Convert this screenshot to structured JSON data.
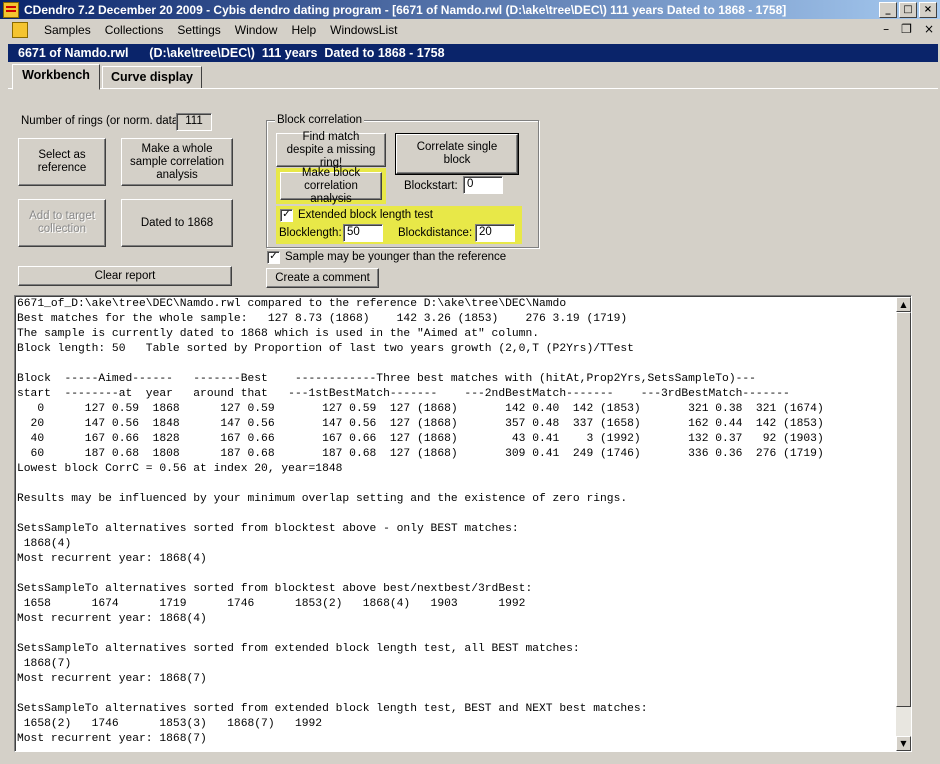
{
  "window": {
    "title": "CDendro 7.2  December 20 2009 - Cybis dendro dating program - [6671 of Namdo.rwl    (D:\\ake\\tree\\DEC\\)  111 years  Dated to 1868 - 1758]",
    "minimize": "_",
    "maximize": "□",
    "close": "×"
  },
  "menu": {
    "items": [
      "Samples",
      "Collections",
      "Settings",
      "Window",
      "Help",
      "WindowsList"
    ],
    "mdi_minimize": "–",
    "mdi_restore": "❐",
    "mdi_close": "×"
  },
  "child_title": "6671 of Namdo.rwl      (D:\\ake\\tree\\DEC\\)  111 years  Dated to 1868 - 1758",
  "tabs": [
    "Workbench",
    "Curve display"
  ],
  "workbench": {
    "rings_label": "Number of rings (or norm. data):",
    "rings_value": "111",
    "select_reference": "Select as reference",
    "whole_sample": "Make a whole sample correlation analysis",
    "add_target": "Add to target collection",
    "dated_to": "Dated to 1868",
    "clear_report": "Clear report",
    "create_comment": "Create a comment"
  },
  "block_correlation": {
    "group_label": "Block correlation",
    "find_match": "Find match despite a missing ring!",
    "make_block": "Make block correlation analysis",
    "correlate_single": "Correlate single block",
    "blockstart_label": "Blockstart:",
    "blockstart_value": "0",
    "extended_label": "Extended block length test",
    "extended_checked": "✓",
    "blocklength_label": "Blocklength:",
    "blocklength_value": "50",
    "blockdistance_label": "Blockdistance:",
    "blockdistance_value": "20",
    "younger_label": "Sample may be younger than the reference",
    "younger_checked": "✓"
  },
  "report_lines": [
    "6671_of_D:\\ake\\tree\\DEC\\Namdo.rwl compared to the reference D:\\ake\\tree\\DEC\\Namdo",
    "Best matches for the whole sample:   127 8.73 (1868)    142 3.26 (1853)    276 3.19 (1719)",
    "The sample is currently dated to 1868 which is used in the \"Aimed at\" column.",
    "Block length: 50   Table sorted by Proportion of last two years growth (2,0,T (P2Yrs)/TTest",
    "",
    "Block  -----Aimed------   -------Best    ------------Three best matches with (hitAt,Prop2Yrs,SetsSampleTo)---",
    "start  --------at  year   around that   ---1stBestMatch-------    ---2ndBestMatch-------    ---3rdBestMatch-------",
    "   0      127 0.59  1868      127 0.59       127 0.59  127 (1868)       142 0.40  142 (1853)       321 0.38  321 (1674)",
    "  20      147 0.56  1848      147 0.56       147 0.56  127 (1868)       357 0.48  337 (1658)       162 0.44  142 (1853)",
    "  40      167 0.66  1828      167 0.66       167 0.66  127 (1868)        43 0.41    3 (1992)       132 0.37   92 (1903)",
    "  60      187 0.68  1808      187 0.68       187 0.68  127 (1868)       309 0.41  249 (1746)       336 0.36  276 (1719)",
    "Lowest block CorrC = 0.56 at index 20, year=1848",
    "",
    "Results may be influenced by your minimum overlap setting and the existence of zero rings.",
    "",
    "SetsSampleTo alternatives sorted from blocktest above - only BEST matches:",
    " 1868(4)",
    "Most recurrent year: 1868(4)",
    "",
    "SetsSampleTo alternatives sorted from blocktest above best/nextbest/3rdBest:",
    " 1658      1674      1719      1746      1853(2)   1868(4)   1903      1992",
    "Most recurrent year: 1868(4)",
    "",
    "SetsSampleTo alternatives sorted from extended block length test, all BEST matches:",
    " 1868(7)",
    "Most recurrent year: 1868(7)",
    "",
    "SetsSampleTo alternatives sorted from extended block length test, BEST and NEXT best matches:",
    " 1658(2)   1746      1853(3)   1868(7)   1992",
    "Most recurrent year: 1868(7)"
  ],
  "scroll": {
    "up": "▲",
    "down": "▼"
  },
  "colors": {
    "titlebar": "#0a246a",
    "highlight": "#e8e848",
    "face": "#d4d0c8"
  }
}
